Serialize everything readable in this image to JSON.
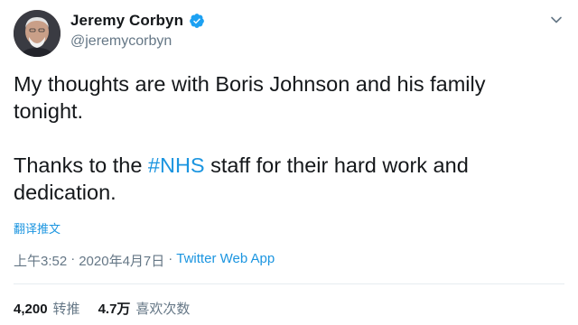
{
  "author": {
    "display_name": "Jeremy Corbyn",
    "handle": "@jeremycorbyn",
    "verified": true
  },
  "tweet": {
    "line1_text": "My thoughts are with Boris Johnson and his family tonight.",
    "line2_prefix": "Thanks to the ",
    "hashtag": "#NHS",
    "line2_suffix": " staff for their hard work and dedication."
  },
  "translate_label": "翻译推文",
  "meta": {
    "time": "上午3:52",
    "separator": "·",
    "date": "2020年4月7日",
    "source": "Twitter Web App"
  },
  "stats": {
    "retweets_count": "4,200",
    "retweets_label": "转推",
    "likes_count": "4.7万",
    "likes_label": "喜欢次数"
  },
  "icons": {
    "verified": "verified-badge-icon",
    "menu": "chevron-down-icon",
    "avatar": "profile-photo"
  },
  "colors": {
    "link": "#1b95e0",
    "secondary_text": "#657786",
    "primary_text": "#14171a",
    "verified": "#1da1f2"
  }
}
